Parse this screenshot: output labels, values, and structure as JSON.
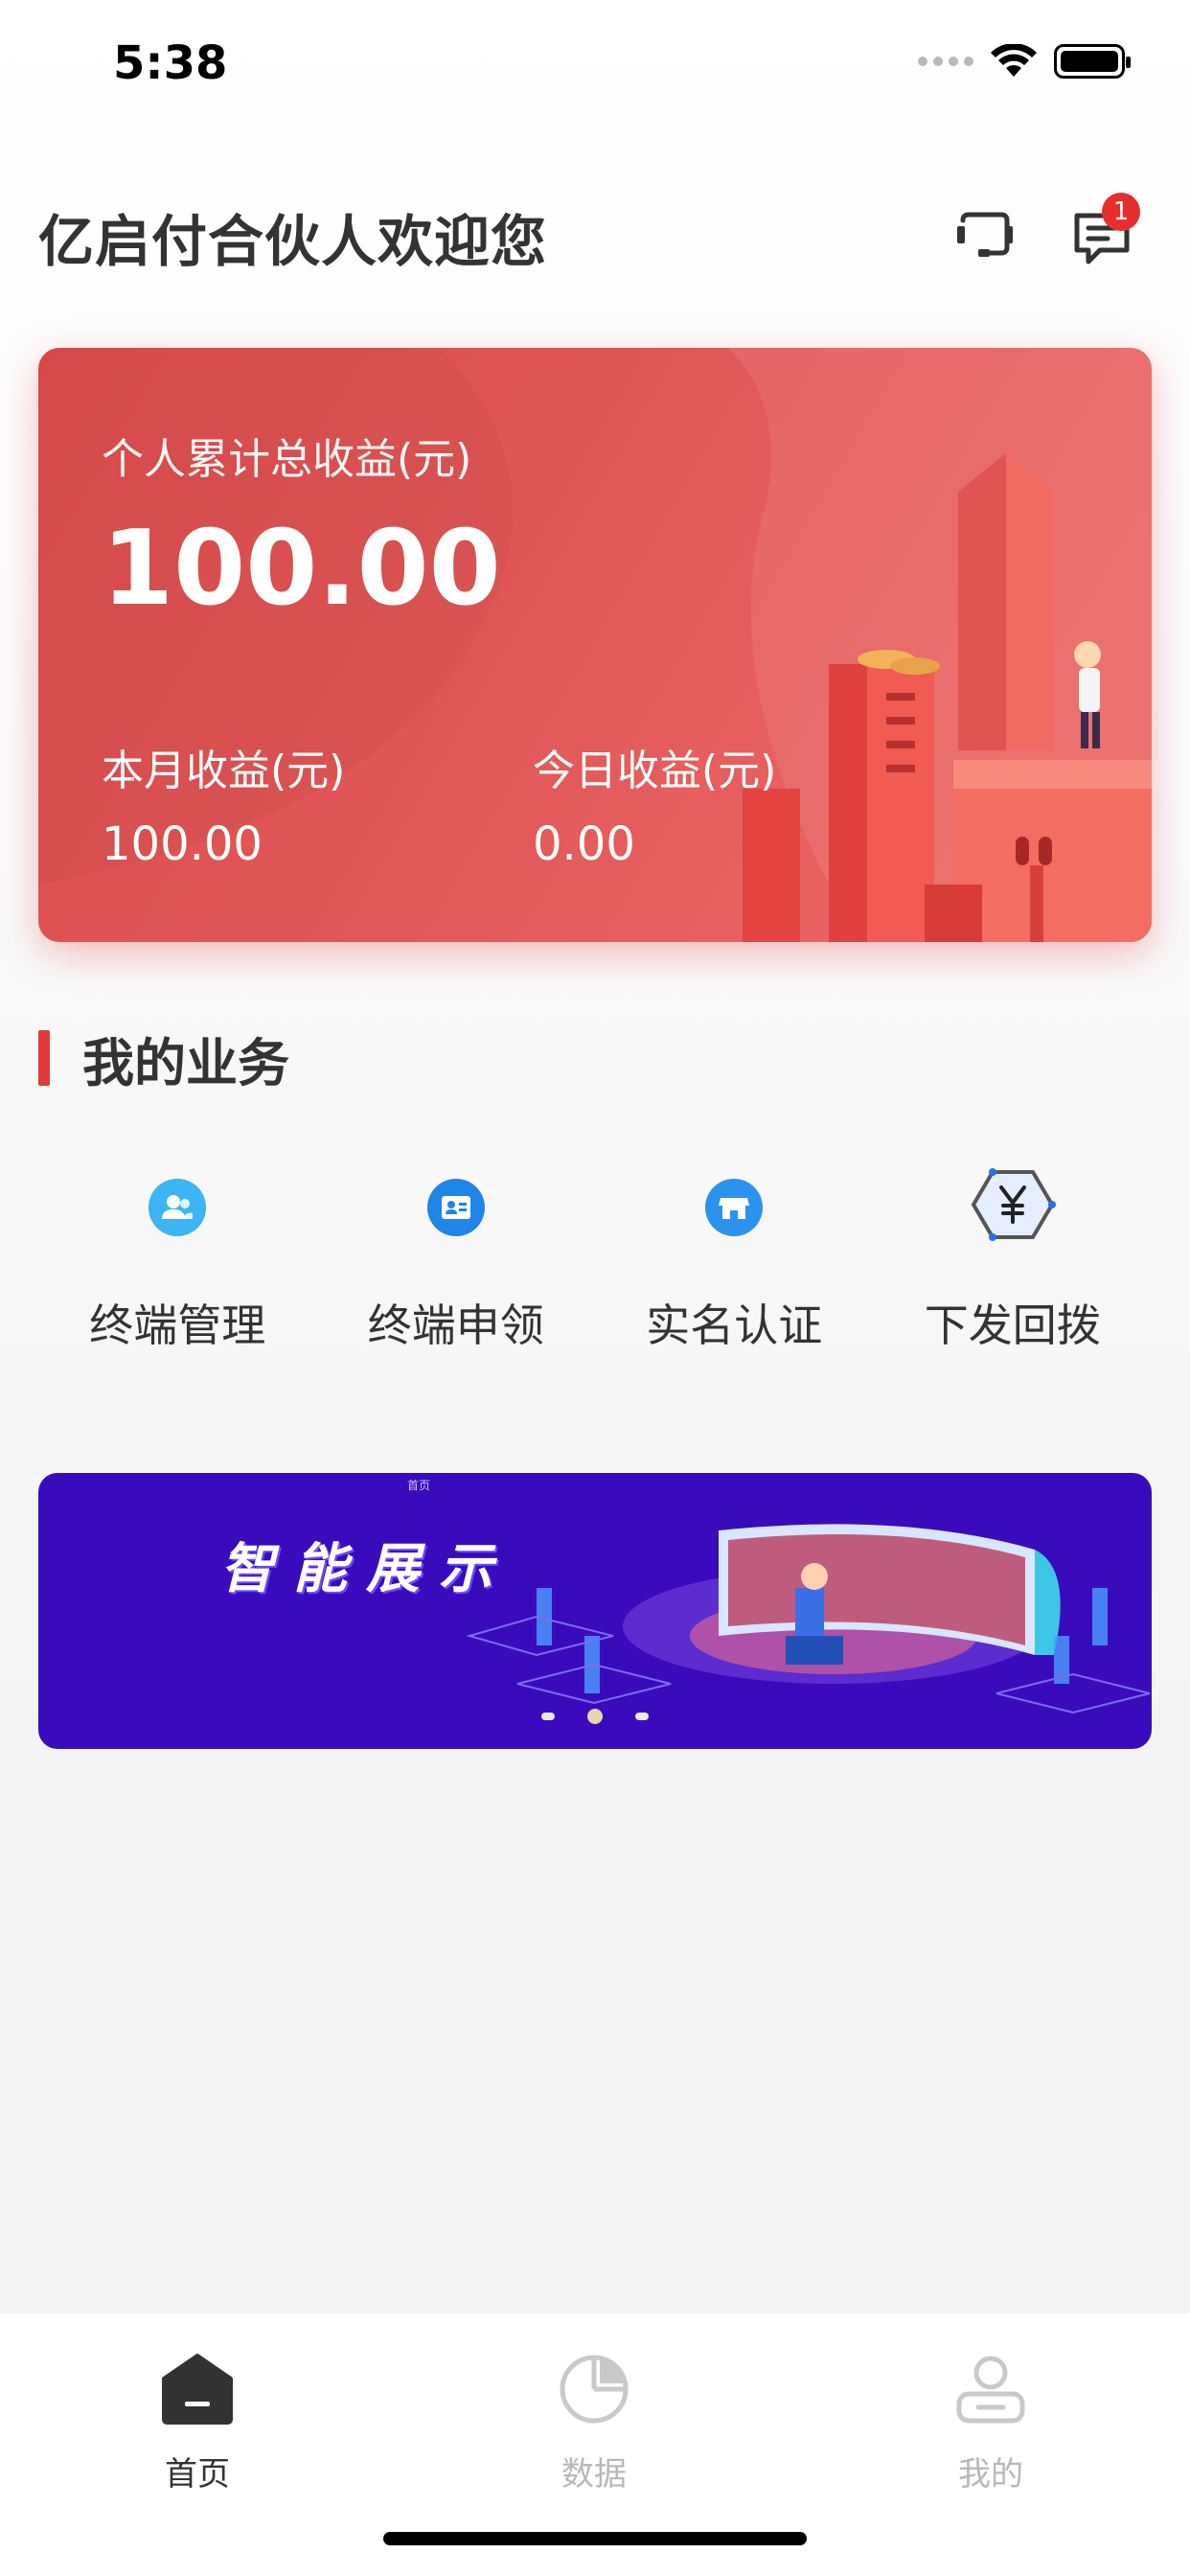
{
  "status_bar": {
    "time": "5:38"
  },
  "header": {
    "greeting": "亿启付合伙人欢迎您",
    "message_badge": "1"
  },
  "earnings": {
    "total_label": "个人累计总收益(元)",
    "total_value": "100.00",
    "month_label": "本月收益(元)",
    "month_value": "100.00",
    "today_label": "今日收益(元)",
    "today_value": "0.00"
  },
  "business": {
    "title": "我的业务",
    "items": [
      {
        "label": "终端管理",
        "icon": "user-group-icon"
      },
      {
        "label": "终端申领",
        "icon": "id-card-icon"
      },
      {
        "label": "实名认证",
        "icon": "store-icon"
      },
      {
        "label": "下发回拨",
        "icon": "yuan-hexagon-icon"
      }
    ]
  },
  "banner": {
    "title": "智能展示",
    "small_text": "首页",
    "slides": 3,
    "active_slide": 2
  },
  "tabbar": {
    "items": [
      {
        "label": "首页",
        "icon": "home-icon",
        "active": true
      },
      {
        "label": "数据",
        "icon": "pie-chart-icon",
        "active": false
      },
      {
        "label": "我的",
        "icon": "person-icon",
        "active": false
      }
    ]
  },
  "colors": {
    "accent_red": "#e23b3b",
    "card_red": "#e05656",
    "icon_blue": "#2fa3f0",
    "banner_purple": "#3a0bbd"
  }
}
